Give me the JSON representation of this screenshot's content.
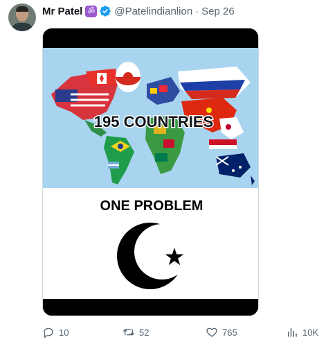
{
  "author": {
    "name": "Mr Patel",
    "badge_glyph": "ॐ",
    "badge_color": "#9b59d0",
    "verified_color": "#1d9bf0",
    "handle": "@Patelindianlion",
    "separator": "·",
    "date": "Sep 26"
  },
  "media": {
    "top_text": "195 COUNTRIES",
    "bottom_text": "ONE PROBLEM",
    "symbol": "crescent-and-star",
    "icon": "world-map-flags"
  },
  "actions": {
    "reply": {
      "icon": "reply-icon",
      "count": "10"
    },
    "retweet": {
      "icon": "retweet-icon",
      "count": "52"
    },
    "like": {
      "icon": "heart-icon",
      "count": "765"
    },
    "views": {
      "icon": "views-icon",
      "count": "10K"
    }
  },
  "colors": {
    "text_primary": "#0f1419",
    "text_secondary": "#536471",
    "ocean": "#a8d4ef"
  }
}
